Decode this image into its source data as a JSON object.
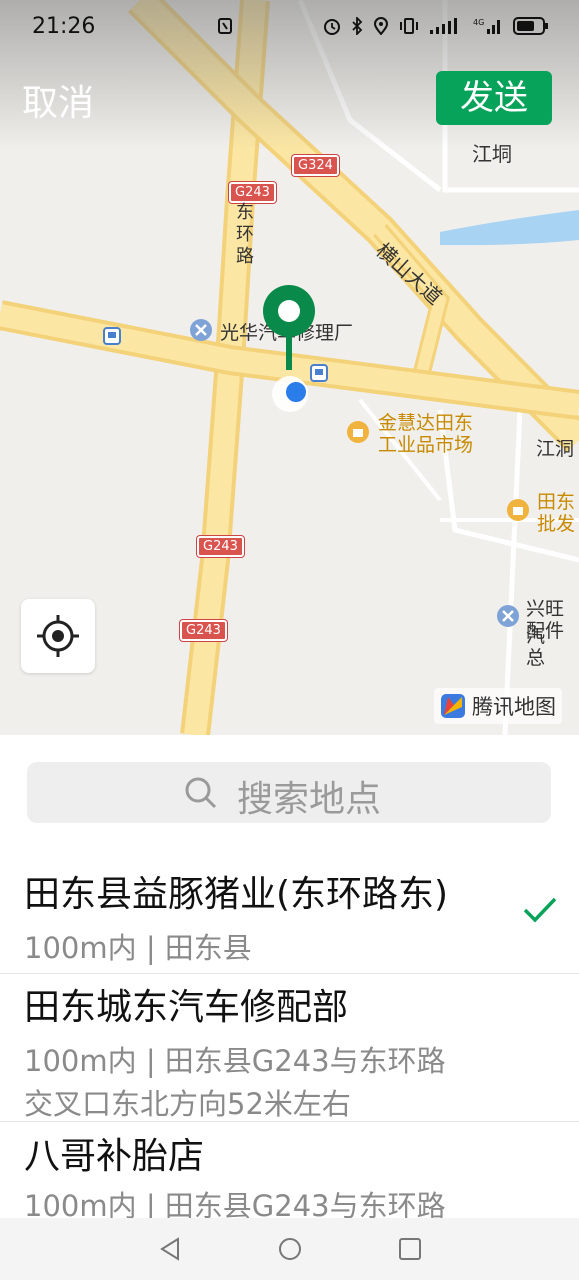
{
  "status_bar": {
    "time": "21:26",
    "icons": [
      "nfc-icon",
      "alarm-icon",
      "bluetooth-icon",
      "location-icon",
      "vibrate-icon",
      "wifi-signal-icon",
      "4g-signal-icon",
      "battery-icon"
    ],
    "network": "4G"
  },
  "header": {
    "cancel_label": "取消",
    "send_label": "发送",
    "send_color": "#07a35a"
  },
  "map": {
    "labels": {
      "jiangtong": "江垌",
      "dongHuanLu": "东环路",
      "hengshanDadao": "横山大道",
      "guanghua": "光华汽车修理厂",
      "jinhuida1": "金慧达田东",
      "jinhuida2": "工业品市场",
      "jiangdong": "江洞",
      "tiandong1": "田东",
      "tiandong2": "批发",
      "xingwang1": "兴旺汽",
      "xingwang2": "配件总"
    },
    "road_signs": {
      "g324": "G324",
      "g243_a": "G243",
      "g243_b": "G243",
      "g243_c": "G243"
    },
    "brand": "腾讯地图",
    "pin_color": "#0a8a4a",
    "location_dot_color": "#2b7de9"
  },
  "search": {
    "placeholder": "搜索地点"
  },
  "results": [
    {
      "title": "田东县益豚猪业(东环路东)",
      "subtitle": "100m内 | 田东县",
      "selected": true
    },
    {
      "title": "田东城东汽车修配部",
      "subtitle_line1": "100m内 | 田东县G243与东环路",
      "subtitle_line2": "交叉口东北方向52米左右",
      "selected": false
    },
    {
      "title": "八哥补胎店",
      "subtitle": "100m内 | 田东县G243与东环路",
      "selected": false
    }
  ],
  "accent_color": "#07a35a"
}
